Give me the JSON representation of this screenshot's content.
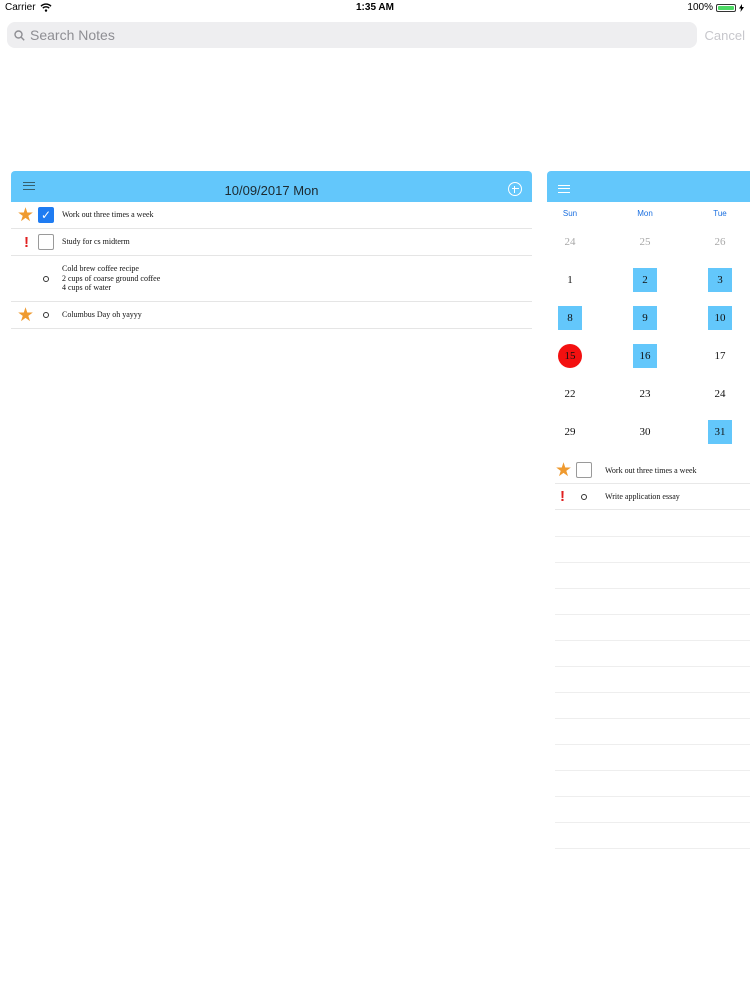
{
  "status_bar": {
    "carrier": "Carrier",
    "time": "1:35 AM",
    "battery": "100%",
    "battery_level": 1.0
  },
  "search": {
    "placeholder": "Search Notes",
    "value": "",
    "cancel_label": "Cancel"
  },
  "day_view": {
    "title": "10/09/2017 Mon",
    "notes": [
      {
        "icon": "star-icon",
        "type": "checkbox",
        "checked": true,
        "text": "Work out three times a week"
      },
      {
        "icon": "exclamation-icon",
        "type": "checkbox",
        "checked": false,
        "text": "Study for cs midterm"
      },
      {
        "icon": "",
        "type": "bullet",
        "checked": false,
        "text": "Cold brew coffee recipe\n2 cups of coarse ground coffee\n4 cups of water"
      },
      {
        "icon": "star-icon",
        "type": "bullet",
        "checked": false,
        "text": "Columbus Day oh yayyy"
      }
    ]
  },
  "calendar": {
    "weekdays": [
      "Sun",
      "Mon",
      "Tue"
    ],
    "weeks": [
      [
        {
          "day": "24",
          "state": "dim"
        },
        {
          "day": "25",
          "state": "dim"
        },
        {
          "day": "26",
          "state": "dim"
        }
      ],
      [
        {
          "day": "1",
          "state": "normal"
        },
        {
          "day": "2",
          "state": "has-note"
        },
        {
          "day": "3",
          "state": "has-note"
        }
      ],
      [
        {
          "day": "8",
          "state": "has-note"
        },
        {
          "day": "9",
          "state": "has-note"
        },
        {
          "day": "10",
          "state": "has-note"
        }
      ],
      [
        {
          "day": "15",
          "state": "today"
        },
        {
          "day": "16",
          "state": "has-note"
        },
        {
          "day": "17",
          "state": "normal"
        }
      ],
      [
        {
          "day": "22",
          "state": "normal"
        },
        {
          "day": "23",
          "state": "normal"
        },
        {
          "day": "24",
          "state": "normal"
        }
      ],
      [
        {
          "day": "29",
          "state": "normal"
        },
        {
          "day": "30",
          "state": "normal"
        },
        {
          "day": "31",
          "state": "has-note"
        }
      ]
    ],
    "notes": [
      {
        "icon": "star-icon",
        "type": "checkbox",
        "checked": false,
        "text": "Work out three times a week"
      },
      {
        "icon": "exclamation-icon",
        "type": "bullet",
        "checked": false,
        "text": "Write application essay"
      }
    ]
  },
  "colors": {
    "header": "#63c7fb",
    "today": "#f31010",
    "star": "#ef9a2f",
    "check": "#1f7cf2",
    "weekday": "#1a6fe0"
  }
}
